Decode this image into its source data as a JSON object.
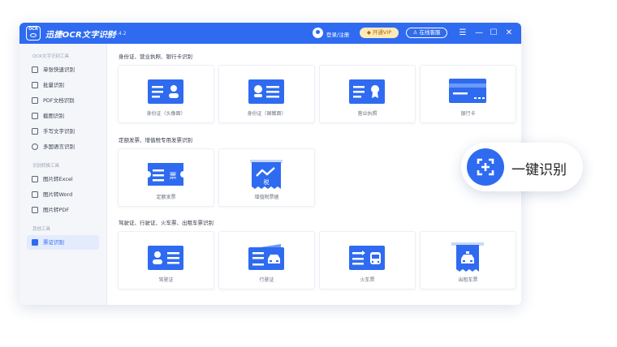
{
  "titlebar": {
    "app_name": "迅捷OCR文字识别",
    "version": "v8.6.4.2",
    "login": "登录/注册",
    "vip": "开通VIP",
    "service": "在线客服",
    "menu_glyph": "☰",
    "min_glyph": "—",
    "max_glyph": "☐",
    "close_glyph": "✕",
    "logo_text": "OCR"
  },
  "sidebar": {
    "sections": [
      {
        "title": "OCR文字识别工具"
      },
      {
        "title": "识别转换工具"
      },
      {
        "title": "其他工具"
      }
    ],
    "items": [
      {
        "label": "单张快速识别",
        "icon": "scan-icon"
      },
      {
        "label": "批量识别",
        "icon": "stack-icon"
      },
      {
        "label": "PDF文档识别",
        "icon": "pdf-icon"
      },
      {
        "label": "截图识别",
        "icon": "crop-icon"
      },
      {
        "label": "手写文字识别",
        "icon": "pen-icon"
      },
      {
        "label": "多国语言识别",
        "icon": "globe-icon"
      },
      {
        "label": "图片转Excel",
        "icon": "excel-icon"
      },
      {
        "label": "图片转Word",
        "icon": "word-icon"
      },
      {
        "label": "图片转PDF",
        "icon": "pdf-icon"
      },
      {
        "label": "票证识别",
        "icon": "ticket-icon",
        "active": true
      }
    ]
  },
  "groups": [
    {
      "title": "身份证、营业执照、银行卡识别",
      "cards": [
        {
          "label": "身份证（头像面）",
          "icon": "id-front-icon"
        },
        {
          "label": "身份证（国徽面）",
          "icon": "id-back-icon"
        },
        {
          "label": "营业执照",
          "icon": "license-icon"
        },
        {
          "label": "银行卡",
          "icon": "bankcard-icon"
        }
      ]
    },
    {
      "title": "定额发票、增值税专用发票识别",
      "cards": [
        {
          "label": "定额发票",
          "icon": "fixed-invoice-icon",
          "glyph": "票"
        },
        {
          "label": "增值税票据",
          "icon": "vat-invoice-icon",
          "glyph": "税"
        }
      ]
    },
    {
      "title": "驾驶证、行驶证、火车票、出租车票识别",
      "cards": [
        {
          "label": "驾驶证",
          "icon": "driver-license-icon"
        },
        {
          "label": "行驶证",
          "icon": "vehicle-license-icon"
        },
        {
          "label": "火车票",
          "icon": "train-ticket-icon"
        },
        {
          "label": "出租车票",
          "icon": "taxi-ticket-icon"
        }
      ]
    }
  ],
  "badge": {
    "label": "一键识别",
    "icon": "scan-plus-icon"
  },
  "colors": {
    "accent": "#2f6bf0",
    "vip_bg": "#ffe9b8",
    "sidebar_bg": "#f4f6fa"
  }
}
